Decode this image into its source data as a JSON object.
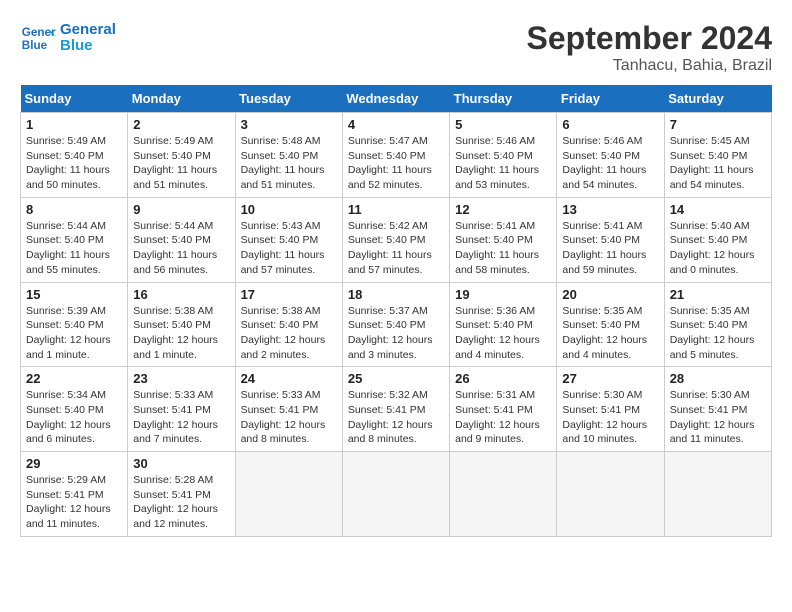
{
  "header": {
    "logo_line1": "General",
    "logo_line2": "Blue",
    "month": "September 2024",
    "location": "Tanhacu, Bahia, Brazil"
  },
  "weekdays": [
    "Sunday",
    "Monday",
    "Tuesday",
    "Wednesday",
    "Thursday",
    "Friday",
    "Saturday"
  ],
  "weeks": [
    [
      {
        "day": "1",
        "info": "Sunrise: 5:49 AM\nSunset: 5:40 PM\nDaylight: 11 hours\nand 50 minutes."
      },
      {
        "day": "2",
        "info": "Sunrise: 5:49 AM\nSunset: 5:40 PM\nDaylight: 11 hours\nand 51 minutes."
      },
      {
        "day": "3",
        "info": "Sunrise: 5:48 AM\nSunset: 5:40 PM\nDaylight: 11 hours\nand 51 minutes."
      },
      {
        "day": "4",
        "info": "Sunrise: 5:47 AM\nSunset: 5:40 PM\nDaylight: 11 hours\nand 52 minutes."
      },
      {
        "day": "5",
        "info": "Sunrise: 5:46 AM\nSunset: 5:40 PM\nDaylight: 11 hours\nand 53 minutes."
      },
      {
        "day": "6",
        "info": "Sunrise: 5:46 AM\nSunset: 5:40 PM\nDaylight: 11 hours\nand 54 minutes."
      },
      {
        "day": "7",
        "info": "Sunrise: 5:45 AM\nSunset: 5:40 PM\nDaylight: 11 hours\nand 54 minutes."
      }
    ],
    [
      {
        "day": "8",
        "info": "Sunrise: 5:44 AM\nSunset: 5:40 PM\nDaylight: 11 hours\nand 55 minutes."
      },
      {
        "day": "9",
        "info": "Sunrise: 5:44 AM\nSunset: 5:40 PM\nDaylight: 11 hours\nand 56 minutes."
      },
      {
        "day": "10",
        "info": "Sunrise: 5:43 AM\nSunset: 5:40 PM\nDaylight: 11 hours\nand 57 minutes."
      },
      {
        "day": "11",
        "info": "Sunrise: 5:42 AM\nSunset: 5:40 PM\nDaylight: 11 hours\nand 57 minutes."
      },
      {
        "day": "12",
        "info": "Sunrise: 5:41 AM\nSunset: 5:40 PM\nDaylight: 11 hours\nand 58 minutes."
      },
      {
        "day": "13",
        "info": "Sunrise: 5:41 AM\nSunset: 5:40 PM\nDaylight: 11 hours\nand 59 minutes."
      },
      {
        "day": "14",
        "info": "Sunrise: 5:40 AM\nSunset: 5:40 PM\nDaylight: 12 hours\nand 0 minutes."
      }
    ],
    [
      {
        "day": "15",
        "info": "Sunrise: 5:39 AM\nSunset: 5:40 PM\nDaylight: 12 hours\nand 1 minute."
      },
      {
        "day": "16",
        "info": "Sunrise: 5:38 AM\nSunset: 5:40 PM\nDaylight: 12 hours\nand 1 minute."
      },
      {
        "day": "17",
        "info": "Sunrise: 5:38 AM\nSunset: 5:40 PM\nDaylight: 12 hours\nand 2 minutes."
      },
      {
        "day": "18",
        "info": "Sunrise: 5:37 AM\nSunset: 5:40 PM\nDaylight: 12 hours\nand 3 minutes."
      },
      {
        "day": "19",
        "info": "Sunrise: 5:36 AM\nSunset: 5:40 PM\nDaylight: 12 hours\nand 4 minutes."
      },
      {
        "day": "20",
        "info": "Sunrise: 5:35 AM\nSunset: 5:40 PM\nDaylight: 12 hours\nand 4 minutes."
      },
      {
        "day": "21",
        "info": "Sunrise: 5:35 AM\nSunset: 5:40 PM\nDaylight: 12 hours\nand 5 minutes."
      }
    ],
    [
      {
        "day": "22",
        "info": "Sunrise: 5:34 AM\nSunset: 5:40 PM\nDaylight: 12 hours\nand 6 minutes."
      },
      {
        "day": "23",
        "info": "Sunrise: 5:33 AM\nSunset: 5:41 PM\nDaylight: 12 hours\nand 7 minutes."
      },
      {
        "day": "24",
        "info": "Sunrise: 5:33 AM\nSunset: 5:41 PM\nDaylight: 12 hours\nand 8 minutes."
      },
      {
        "day": "25",
        "info": "Sunrise: 5:32 AM\nSunset: 5:41 PM\nDaylight: 12 hours\nand 8 minutes."
      },
      {
        "day": "26",
        "info": "Sunrise: 5:31 AM\nSunset: 5:41 PM\nDaylight: 12 hours\nand 9 minutes."
      },
      {
        "day": "27",
        "info": "Sunrise: 5:30 AM\nSunset: 5:41 PM\nDaylight: 12 hours\nand 10 minutes."
      },
      {
        "day": "28",
        "info": "Sunrise: 5:30 AM\nSunset: 5:41 PM\nDaylight: 12 hours\nand 11 minutes."
      }
    ],
    [
      {
        "day": "29",
        "info": "Sunrise: 5:29 AM\nSunset: 5:41 PM\nDaylight: 12 hours\nand 11 minutes."
      },
      {
        "day": "30",
        "info": "Sunrise: 5:28 AM\nSunset: 5:41 PM\nDaylight: 12 hours\nand 12 minutes."
      },
      {
        "day": "",
        "info": ""
      },
      {
        "day": "",
        "info": ""
      },
      {
        "day": "",
        "info": ""
      },
      {
        "day": "",
        "info": ""
      },
      {
        "day": "",
        "info": ""
      }
    ]
  ]
}
